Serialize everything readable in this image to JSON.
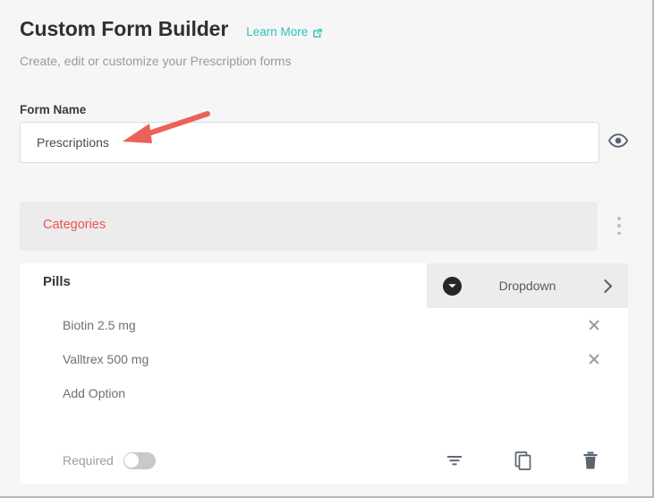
{
  "header": {
    "title": "Custom Form Builder",
    "learn_more_label": "Learn More",
    "learn_more_icon": "external-link-icon",
    "subtitle": "Create, edit or customize your Prescription forms",
    "accent_color": "#2ec4b6"
  },
  "form_name": {
    "label": "Form Name",
    "value": "Prescriptions",
    "placeholder": "Form Name",
    "preview_icon": "eye-icon"
  },
  "categories": {
    "label": "Categories",
    "label_color": "#ef5350",
    "menu_icon": "kebab-menu-icon"
  },
  "field": {
    "title": "Pills",
    "type_label": "Dropdown",
    "type_icon": "chevron-down-circle-icon",
    "type_expand_icon": "chevron-right-icon",
    "options": [
      {
        "text": "Biotin 2.5 mg",
        "remove_icon": "close-icon"
      },
      {
        "text": "Valltrex 500 mg",
        "remove_icon": "close-icon"
      }
    ],
    "add_option_label": "Add Option",
    "footer": {
      "required_label": "Required",
      "required_enabled": false,
      "actions": [
        {
          "name": "settings-filter-icon"
        },
        {
          "name": "duplicate-icon"
        },
        {
          "name": "delete-icon"
        }
      ]
    }
  },
  "annotation": {
    "arrow_color": "#ec6159",
    "points_to": "form-name-input"
  }
}
